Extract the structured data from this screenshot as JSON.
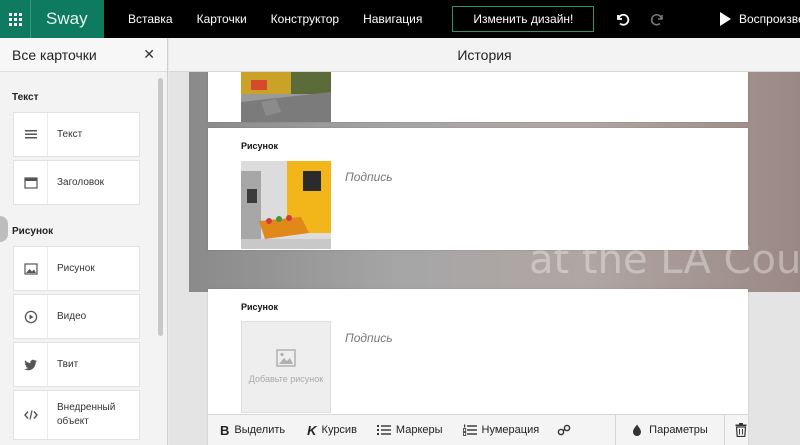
{
  "app": {
    "name": "Sway"
  },
  "topbar": {
    "menu": [
      "Вставка",
      "Карточки",
      "Конструктор",
      "Навигация"
    ],
    "design_button": "Изменить дизайн!",
    "play_label": "Воспроизве"
  },
  "left_panel": {
    "title": "Все карточки",
    "sections": [
      {
        "label": "Текст",
        "items": [
          {
            "label": "Текст",
            "icon": "text-lines-icon"
          },
          {
            "label": "Заголовок",
            "icon": "heading-icon"
          }
        ]
      },
      {
        "label": "Рисунок",
        "items": [
          {
            "label": "Рисунок",
            "icon": "image-icon"
          },
          {
            "label": "Видео",
            "icon": "play-circle-icon"
          },
          {
            "label": "Твит",
            "icon": "twitter-bird-icon"
          },
          {
            "label": "Внедренный объект",
            "icon": "embed-code-icon"
          }
        ]
      }
    ]
  },
  "main": {
    "header_title": "История",
    "background_text": "at the LA County",
    "cards": [
      {
        "title": "Рисунок",
        "caption": "Подпись"
      },
      {
        "title": "Рисунок",
        "caption": "Подпись",
        "placeholder": "Добавьте рисунок"
      }
    ]
  },
  "toolbar": {
    "bold": {
      "icon_text": "B",
      "label": "Выделить"
    },
    "italic": {
      "icon_text": "K",
      "label": "Курсив"
    },
    "bullets": {
      "label": "Маркеры"
    },
    "numbering": {
      "label": "Нумерация"
    },
    "params": {
      "label": "Параметры"
    }
  },
  "colors": {
    "brand": "#0e7a5f",
    "topbar": "#000000"
  }
}
